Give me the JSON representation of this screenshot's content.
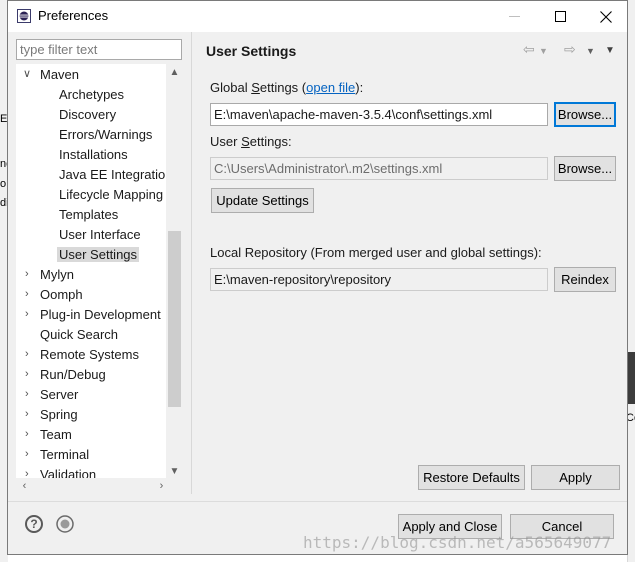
{
  "window": {
    "title": "Preferences"
  },
  "filter": {
    "placeholder": "type filter text"
  },
  "tree": {
    "maven": "Maven",
    "maven_children": [
      "Archetypes",
      "Discovery",
      "Errors/Warnings",
      "Installations",
      "Java EE Integration",
      "Lifecycle Mapping",
      "Templates",
      "User Interface",
      "User Settings"
    ],
    "siblings": [
      "Mylyn",
      "Oomph",
      "Plug-in Development",
      "Quick Search",
      "Remote Systems",
      "Run/Debug",
      "Server",
      "Spring",
      "Team",
      "Terminal",
      "Validation"
    ]
  },
  "panel": {
    "title": "User Settings",
    "global_label_pre": "Global ",
    "global_label_ul": "S",
    "global_label_post": "ettings (",
    "open_file": "open file",
    "global_label_end": "):",
    "global_value": "E:\\maven\\apache-maven-3.5.4\\conf\\settings.xml",
    "browse": "Browse...",
    "user_label_pre": "User ",
    "user_label_ul": "S",
    "user_label_post": "ettings:",
    "user_value": "C:\\Users\\Administrator\\.m2\\settings.xml",
    "update": "Update Settings",
    "local_label": "Local Repository (From merged user and global settings):",
    "local_value": "E:\\maven-repository\\repository",
    "reindex": "Reindex",
    "restore": "Restore Defaults",
    "apply": "Apply"
  },
  "footer": {
    "apply_close": "Apply and Close",
    "cancel": "Cancel"
  },
  "watermark": "https://blog.csdn.net/a565649077",
  "background_fragments": [
    "E:",
    "ne",
    "o",
    "di",
    "Co"
  ]
}
